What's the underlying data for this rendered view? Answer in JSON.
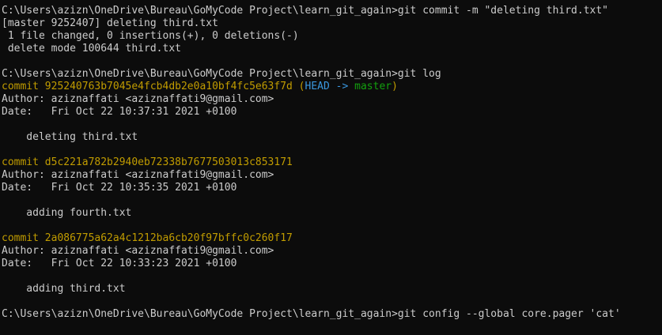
{
  "colors": {
    "background": "#0c0c0c",
    "text": "#cccccc",
    "commit_hash": "#c19c00",
    "head_ref": "#3a96dd",
    "branch": "#13a10e"
  },
  "lines": [
    {
      "type": "prompt",
      "text": "C:\\Users\\azizn\\OneDrive\\Bureau\\GoMyCode Project\\learn_git_again>git commit -m \"deleting third.txt\""
    },
    {
      "type": "text",
      "text": "[master 9252407] deleting third.txt"
    },
    {
      "type": "text",
      "text": " 1 file changed, 0 insertions(+), 0 deletions(-)"
    },
    {
      "type": "text",
      "text": " delete mode 100644 third.txt"
    },
    {
      "type": "blank",
      "text": ""
    },
    {
      "type": "prompt",
      "text": "C:\\Users\\azizn\\OneDrive\\Bureau\\GoMyCode Project\\learn_git_again>git log"
    },
    {
      "type": "commit_head",
      "hash": "commit 925240763b7045e4fcb4db2e0a10bf4fc5e63f7d",
      "open": " (",
      "head": "HEAD -> ",
      "branch": "master",
      "close": ")"
    },
    {
      "type": "text",
      "text": "Author: aziznaffati <aziznaffati9@gmail.com>"
    },
    {
      "type": "text",
      "text": "Date:   Fri Oct 22 10:37:31 2021 +0100"
    },
    {
      "type": "blank",
      "text": ""
    },
    {
      "type": "text",
      "text": "    deleting third.txt"
    },
    {
      "type": "blank",
      "text": ""
    },
    {
      "type": "commit",
      "hash": "commit d5c221a782b2940eb72338b7677503013c853171"
    },
    {
      "type": "text",
      "text": "Author: aziznaffati <aziznaffati9@gmail.com>"
    },
    {
      "type": "text",
      "text": "Date:   Fri Oct 22 10:35:35 2021 +0100"
    },
    {
      "type": "blank",
      "text": ""
    },
    {
      "type": "text",
      "text": "    adding fourth.txt"
    },
    {
      "type": "blank",
      "text": ""
    },
    {
      "type": "commit",
      "hash": "commit 2a086775a62a4c1212ba6cb20f97bffc0c260f17"
    },
    {
      "type": "text",
      "text": "Author: aziznaffati <aziznaffati9@gmail.com>"
    },
    {
      "type": "text",
      "text": "Date:   Fri Oct 22 10:33:23 2021 +0100"
    },
    {
      "type": "blank",
      "text": ""
    },
    {
      "type": "text",
      "text": "    adding third.txt"
    },
    {
      "type": "blank",
      "text": ""
    },
    {
      "type": "prompt",
      "text": "C:\\Users\\azizn\\OneDrive\\Bureau\\GoMyCode Project\\learn_git_again>git config --global core.pager 'cat'"
    }
  ]
}
